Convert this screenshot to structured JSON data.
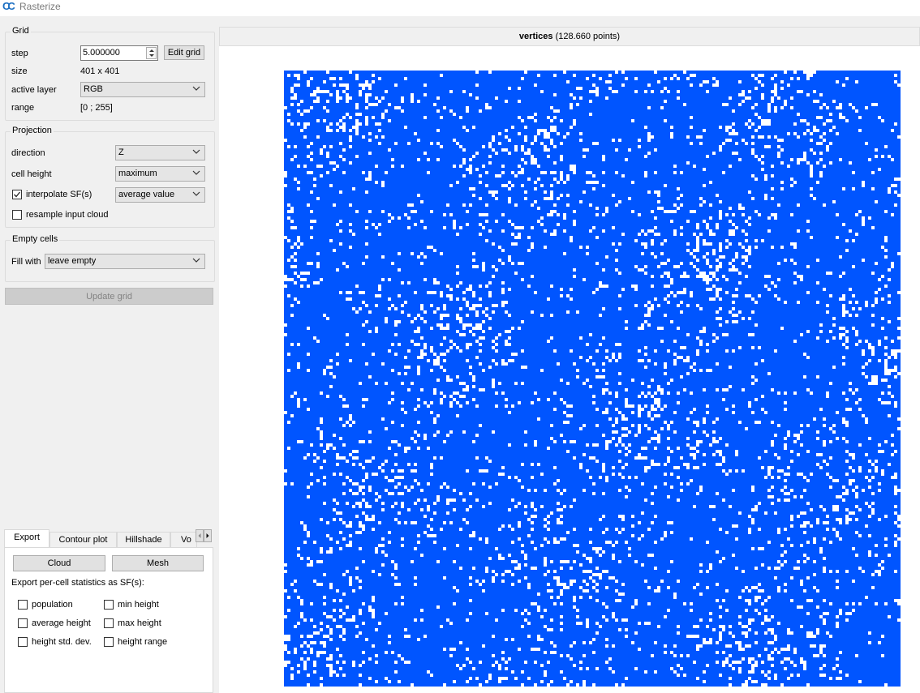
{
  "window": {
    "title": "Rasterize"
  },
  "grid": {
    "title": "Grid",
    "step_label": "step",
    "step_value": "5.000000",
    "edit_grid_label": "Edit grid",
    "size_label": "size",
    "size_value": "401 x 401",
    "active_layer_label": "active layer",
    "active_layer_value": "RGB",
    "range_label": "range",
    "range_value": "[0 ; 255]"
  },
  "projection": {
    "title": "Projection",
    "direction_label": "direction",
    "direction_value": "Z",
    "cell_height_label": "cell height",
    "cell_height_value": "maximum",
    "interpolate_label": "interpolate SF(s)",
    "interpolate_checked": true,
    "interpolate_value": "average value",
    "resample_label": "resample input cloud",
    "resample_checked": false
  },
  "empty_cells": {
    "title": "Empty cells",
    "fill_label": "Fill with",
    "fill_value": "leave empty"
  },
  "update_grid_label": "Update grid",
  "tabs": {
    "items": [
      {
        "label": "Export",
        "active": true
      },
      {
        "label": "Contour plot",
        "active": false
      },
      {
        "label": "Hillshade",
        "active": false
      },
      {
        "label": "Vo",
        "active": false
      }
    ]
  },
  "export": {
    "cloud_label": "Cloud",
    "mesh_label": "Mesh",
    "stats_label": "Export per-cell statistics as SF(s):",
    "stats": [
      {
        "label": "population",
        "checked": false
      },
      {
        "label": "min height",
        "checked": false
      },
      {
        "label": "average height",
        "checked": false
      },
      {
        "label": "max height",
        "checked": false
      },
      {
        "label": "height std. dev.",
        "checked": false
      },
      {
        "label": "height range",
        "checked": false
      }
    ]
  },
  "plot": {
    "title_bold": "vertices",
    "title_rest": "(128.660 points)",
    "fill_color": "#0055ff",
    "empty_color": "#ffffff"
  },
  "icons": {
    "app": "cloudcompare-logo-icon",
    "chevron": "chevron-down-icon",
    "check": "check-icon"
  }
}
